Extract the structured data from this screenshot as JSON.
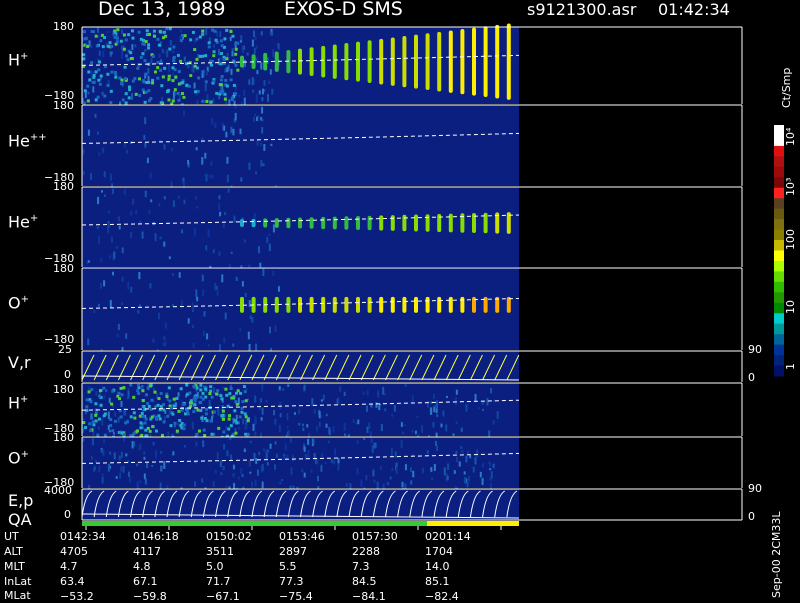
{
  "header": {
    "date": "Dec 13, 1989",
    "instrument": "EXOS-D SMS",
    "file": "s9121300.asr",
    "time": "01:42:34"
  },
  "colors": {
    "background": "#000000",
    "text": "#ffffff",
    "plot_bg": "#0a1f80",
    "trace": "#ffff40",
    "qa_green": "#33cc33",
    "qa_yellow": "#ffee00"
  },
  "panels": [
    {
      "name": "H+",
      "label_main": "H",
      "label_sup": "+",
      "ticks": [
        "180",
        "−180"
      ]
    },
    {
      "name": "He++",
      "label_main": "He",
      "label_sup": "++",
      "ticks": [
        "180",
        "−180"
      ]
    },
    {
      "name": "He+",
      "label_main": "He",
      "label_sup": "+",
      "ticks": [
        "180",
        "−180"
      ]
    },
    {
      "name": "O+",
      "label_main": "O",
      "label_sup": "+",
      "ticks": [
        "180",
        "−180"
      ]
    },
    {
      "name": "V,r",
      "label_main": "V,r",
      "label_sup": "",
      "ticks": [
        "25",
        "0"
      ],
      "right_ticks": [
        "90",
        "0"
      ]
    },
    {
      "name": "H+ (2)",
      "label_main": "H",
      "label_sup": "+",
      "ticks": [
        "180",
        "−180"
      ]
    },
    {
      "name": "O+ (2)",
      "label_main": "O",
      "label_sup": "+",
      "ticks": [
        "180",
        "−180"
      ]
    },
    {
      "name": "E,p",
      "label_main": "E,p",
      "label_sup": "",
      "ticks": [
        "4000",
        "0"
      ],
      "right_ticks": [
        "90",
        "0"
      ]
    }
  ],
  "qa_label": "QA",
  "colorbar": {
    "unit": "Ct/Smp",
    "ticks": [
      "10",
      "10",
      "100",
      "10",
      "10",
      "1"
    ],
    "tick_sups": [
      "4",
      "3",
      "",
      "",
      "",
      ""
    ],
    "tick_display": [
      "10⁴",
      "10³",
      "100",
      "10",
      "1"
    ],
    "colors": [
      "#ffffff",
      "#ffffff",
      "#e01010",
      "#b01010",
      "#9a0c0c",
      "#7a0808",
      "#ff2020",
      "#5a4020",
      "#6a5a10",
      "#807010",
      "#8a8000",
      "#c8b800",
      "#ffff00",
      "#aaff00",
      "#66dd00",
      "#33bb00",
      "#229900",
      "#008800",
      "#00cccc",
      "#009999",
      "#006699",
      "#003399",
      "#002277",
      "#001166"
    ]
  },
  "footer": {
    "row_labels": [
      "UT",
      "ALT",
      "MLT",
      "InLat",
      "MLat"
    ],
    "columns": [
      [
        "0142:34",
        "4705",
        "4.7",
        "63.4",
        "−53.2"
      ],
      [
        "0146:18",
        "4117",
        "4.8",
        "67.1",
        "−59.8"
      ],
      [
        "0150:02",
        "3511",
        "5.0",
        "71.7",
        "−67.1"
      ],
      [
        "0153:46",
        "2897",
        "5.5",
        "77.3",
        "−75.4"
      ],
      [
        "0157:30",
        "2288",
        "7.3",
        "84.5",
        "−84.1"
      ],
      [
        "0201:14",
        "1704",
        "14.0",
        "85.1",
        "−82.4"
      ]
    ],
    "stamp": "Sep-00 2CM33L"
  },
  "chart_data": {
    "type": "heatmap",
    "title": "Dec 13, 1989   EXOS-D SMS",
    "x_ticks": [
      "0142:34",
      "0146:18",
      "0150:02",
      "0153:46",
      "0157:30",
      "0201:14"
    ],
    "panels": [
      "H+",
      "He++",
      "He+",
      "O+",
      "V,r",
      "H+",
      "O+",
      "E,p"
    ],
    "angle_range": [
      -180,
      180
    ],
    "vr_range": [
      0,
      25
    ],
    "ep_range": [
      0,
      4000
    ],
    "colorbar_range": [
      1,
      10000
    ],
    "colorbar_scale": "log"
  }
}
